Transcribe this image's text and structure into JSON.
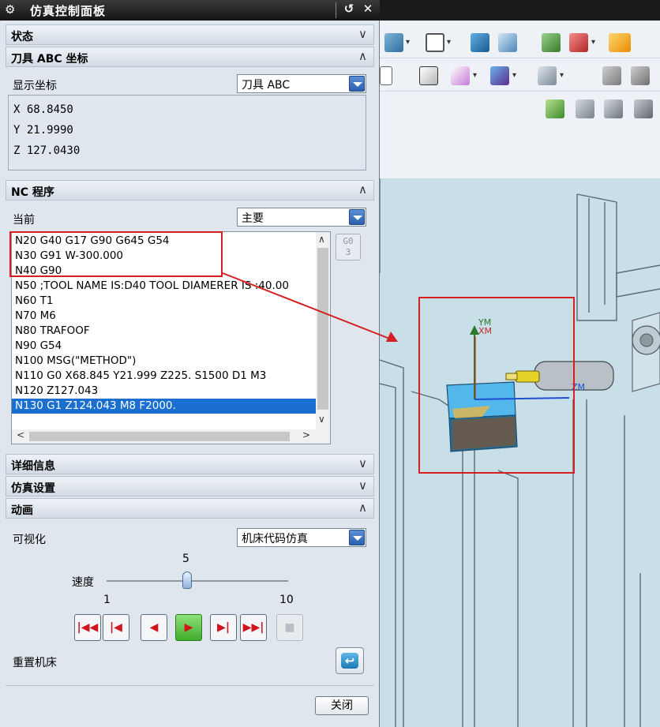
{
  "dialog": {
    "title": "仿真控制面板",
    "controls": {
      "reset_glyph": "↺",
      "close_glyph": "✕"
    }
  },
  "sections": {
    "status": {
      "title": "状态",
      "state": "collapsed"
    },
    "tool_coord": {
      "title": "刀具 ABC 坐标",
      "state": "expanded",
      "display_label": "显示坐标",
      "display_value": "刀具 ABC",
      "x": "X 68.8450",
      "y": "Y 21.9990",
      "z": "Z 127.0430"
    },
    "nc_program": {
      "title": "NC 程序",
      "state": "expanded",
      "current_label": "当前",
      "current_value": "主要",
      "lines": [
        "N20 G40 G17 G90 G645 G54",
        "N30 G91 W-300.000",
        "N40 G90",
        "N50 ;TOOL NAME IS:D40 TOOL DIAMERER IS :40.00",
        "N60 T1",
        "N70 M6",
        "N80 TRAFOOF",
        "N90 G54",
        "N100 MSG(\"METHOD\")",
        "N110 G0 X68.845 Y21.999 Z225. S1500 D1 M3",
        "N120 Z127.043",
        "N130 G1 Z124.043 M8 F2000."
      ],
      "selected_index": 11,
      "g0_button": {
        "line1": "G0",
        "line2": "3"
      }
    },
    "details": {
      "title": "详细信息",
      "state": "collapsed"
    },
    "sim_settings": {
      "title": "仿真设置",
      "state": "collapsed"
    },
    "animation": {
      "title": "动画",
      "state": "expanded",
      "visualize_label": "可视化",
      "visualize_value": "机床代码仿真",
      "speed_label": "速度",
      "speed_value": "5",
      "speed_min": "1",
      "speed_max": "10",
      "reset_label": "重置机床"
    }
  },
  "transport": [
    {
      "name": "step-to-start",
      "glyph": "|◀◀"
    },
    {
      "name": "step-back",
      "glyph": "|◀"
    },
    {
      "name": "play-reverse",
      "glyph": "◀"
    },
    {
      "name": "play-forward",
      "glyph": "▶"
    },
    {
      "name": "step-forward",
      "glyph": "▶|"
    },
    {
      "name": "step-to-end",
      "glyph": "▶▶|"
    },
    {
      "name": "stop",
      "glyph": "■"
    }
  ],
  "footer": {
    "close_label": "关闭"
  },
  "viewport": {
    "axis_labels": {
      "ym": "YM",
      "xm": "XM",
      "zm": "ZM"
    }
  },
  "colors": {
    "annotation_red": "#d61f1f",
    "selection_blue": "#1b6fd0",
    "viewport_bg": "#c9dfe8"
  }
}
